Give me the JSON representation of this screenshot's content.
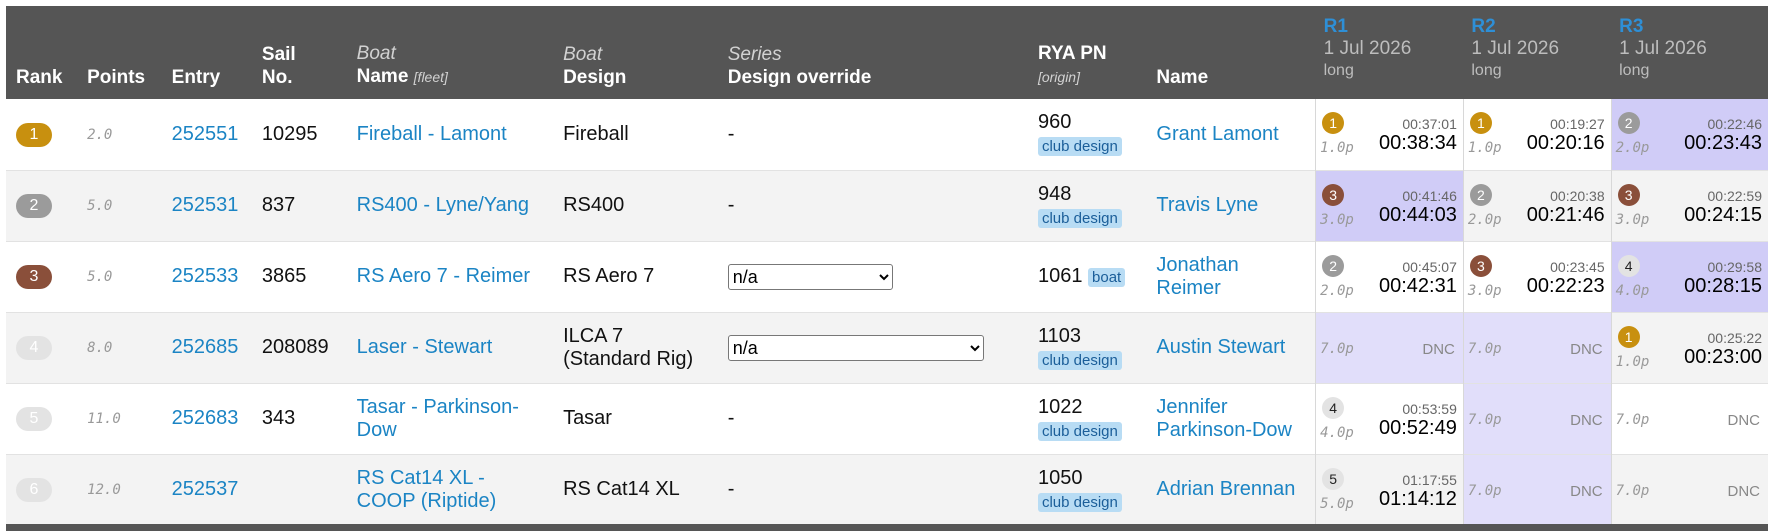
{
  "header": {
    "rank": "Rank",
    "points": "Points",
    "entry": "Entry",
    "sail_line1": "Sail",
    "sail_line2": "No.",
    "boat_name_top": "Boat",
    "boat_name_bottom": "Name",
    "boat_name_hint": "[fleet]",
    "boat_design_top": "Boat",
    "boat_design_bottom": "Design",
    "series_top": "Series",
    "series_bottom": "Design override",
    "rya_pn": "RYA PN",
    "rya_pn_hint": "[origin]",
    "name": "Name",
    "races": [
      {
        "label": "R1",
        "date": "1 Jul 2026",
        "type": "long"
      },
      {
        "label": "R2",
        "date": "1 Jul 2026",
        "type": "long"
      },
      {
        "label": "R3",
        "date": "1 Jul 2026",
        "type": "long"
      }
    ]
  },
  "rows": [
    {
      "rank": "1",
      "points": "2.0",
      "entry": "252551",
      "sail": "10295",
      "boat_name": "Fireball - Lamont",
      "design": "Fireball",
      "override": "-",
      "override_select": false,
      "pn": "960",
      "pn_tag": "club design",
      "name": "Grant Lamont",
      "races": [
        {
          "pos": "1",
          "pts": "1.0p",
          "elapsed": "00:37:01",
          "corrected": "00:38:34",
          "dnc": false
        },
        {
          "pos": "1",
          "pts": "1.0p",
          "elapsed": "00:19:27",
          "corrected": "00:20:16",
          "dnc": false
        },
        {
          "pos": "2",
          "pts": "2.0p",
          "elapsed": "00:22:46",
          "corrected": "00:23:43",
          "dnc": false
        }
      ]
    },
    {
      "rank": "2",
      "points": "5.0",
      "entry": "252531",
      "sail": "837",
      "boat_name": "RS400 - Lyne/Yang",
      "design": "RS400",
      "override": "-",
      "override_select": false,
      "pn": "948",
      "pn_tag": "club design",
      "name": "Travis Lyne",
      "races": [
        {
          "pos": "3",
          "pts": "3.0p",
          "elapsed": "00:41:46",
          "corrected": "00:44:03",
          "dnc": false
        },
        {
          "pos": "2",
          "pts": "2.0p",
          "elapsed": "00:20:38",
          "corrected": "00:21:46",
          "dnc": false
        },
        {
          "pos": "3",
          "pts": "3.0p",
          "elapsed": "00:22:59",
          "corrected": "00:24:15",
          "dnc": false
        }
      ]
    },
    {
      "rank": "3",
      "points": "5.0",
      "entry": "252533",
      "sail": "3865",
      "boat_name": "RS Aero 7 - Reimer",
      "design": "RS Aero 7",
      "override": "n/a",
      "override_select": true,
      "pn": "1061",
      "pn_tag": "boat",
      "name": "Jonathan Reimer",
      "races": [
        {
          "pos": "2",
          "pts": "2.0p",
          "elapsed": "00:45:07",
          "corrected": "00:42:31",
          "dnc": false
        },
        {
          "pos": "3",
          "pts": "3.0p",
          "elapsed": "00:23:45",
          "corrected": "00:22:23",
          "dnc": false
        },
        {
          "pos": "4",
          "pts": "4.0p",
          "elapsed": "00:29:58",
          "corrected": "00:28:15",
          "dnc": false
        }
      ]
    },
    {
      "rank": "4",
      "points": "8.0",
      "entry": "252685",
      "sail": "208089",
      "boat_name": "Laser - Stewart",
      "design": "ILCA 7 (Standard Rig)",
      "override": "n/a",
      "override_select": true,
      "pn": "1103",
      "pn_tag": "club design",
      "name": "Austin Stewart",
      "races": [
        {
          "pos": "",
          "pts": "7.0p",
          "elapsed": "",
          "corrected": "",
          "dnc": true,
          "dnc_label": "DNC"
        },
        {
          "pos": "",
          "pts": "7.0p",
          "elapsed": "",
          "corrected": "",
          "dnc": true,
          "dnc_label": "DNC"
        },
        {
          "pos": "1",
          "pts": "1.0p",
          "elapsed": "00:25:22",
          "corrected": "00:23:00",
          "dnc": false
        }
      ]
    },
    {
      "rank": "5",
      "points": "11.0",
      "entry": "252683",
      "sail": "343",
      "boat_name": "Tasar - Parkinson-Dow",
      "design": "Tasar",
      "override": "-",
      "override_select": false,
      "pn": "1022",
      "pn_tag": "club design",
      "name": "Jennifer Parkinson-Dow",
      "races": [
        {
          "pos": "4",
          "pts": "4.0p",
          "elapsed": "00:53:59",
          "corrected": "00:52:49",
          "dnc": false
        },
        {
          "pos": "",
          "pts": "7.0p",
          "elapsed": "",
          "corrected": "",
          "dnc": true,
          "dnc_label": "DNC"
        },
        {
          "pos": "",
          "pts": "7.0p",
          "elapsed": "",
          "corrected": "",
          "dnc": true,
          "dnc_label": "DNC"
        }
      ]
    },
    {
      "rank": "6",
      "points": "12.0",
      "entry": "252537",
      "sail": "",
      "boat_name": "RS Cat14 XL - COOP (Riptide)",
      "design": "RS Cat14 XL",
      "override": "-",
      "override_select": false,
      "pn": "1050",
      "pn_tag": "club design",
      "name": "Adrian Brennan",
      "races": [
        {
          "pos": "5",
          "pts": "5.0p",
          "elapsed": "01:17:55",
          "corrected": "01:14:12",
          "dnc": false
        },
        {
          "pos": "",
          "pts": "7.0p",
          "elapsed": "",
          "corrected": "",
          "dnc": true,
          "dnc_label": "DNC"
        },
        {
          "pos": "",
          "pts": "7.0p",
          "elapsed": "",
          "corrected": "",
          "dnc": true,
          "dnc_label": "DNC"
        }
      ]
    }
  ],
  "highlight": {
    "r1": [
      false,
      true,
      false,
      true,
      false,
      false
    ],
    "r2": [
      false,
      false,
      false,
      true,
      true,
      true
    ],
    "r3": [
      true,
      false,
      true,
      false,
      false,
      false
    ]
  },
  "colors": {
    "header_bg": "#555555",
    "link": "#1b84c4",
    "race_highlight": "#d0ccf7",
    "gold": "#c8900f",
    "silver": "#9b9b9b",
    "bronze": "#8a4f3a"
  }
}
